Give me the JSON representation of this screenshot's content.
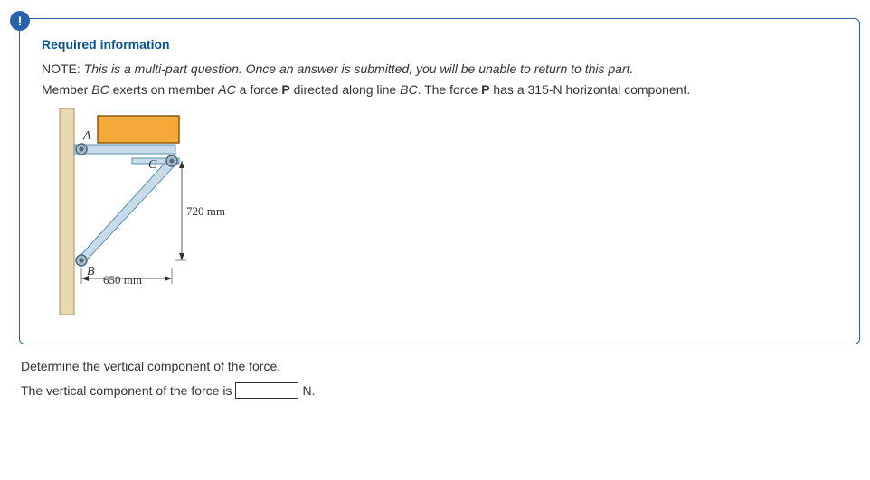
{
  "alert": {
    "symbol": "!"
  },
  "info": {
    "heading": "Required information",
    "note_label": "NOTE: ",
    "note_italic": "This is a multi-part question. Once an answer is submitted, you will be unable to return to this part.",
    "problem_prefix": "Member ",
    "var_bc": "BC",
    "problem_mid1": " exerts on member ",
    "var_ac": "AC",
    "problem_mid2": " a force ",
    "var_p1": "P",
    "problem_mid3": " directed along line ",
    "var_bc2": "BC",
    "problem_mid4": ". The force ",
    "var_p2": "P",
    "problem_tail": " has a 315-N horizontal component."
  },
  "figure": {
    "label_a": "A",
    "label_b": "B",
    "label_c": "C",
    "dim_v": "720 mm",
    "dim_h": "650 mm"
  },
  "question": "Determine the vertical component of the force.",
  "answer": {
    "prefix": "The vertical component of the force is",
    "value": "",
    "unit": "N."
  }
}
